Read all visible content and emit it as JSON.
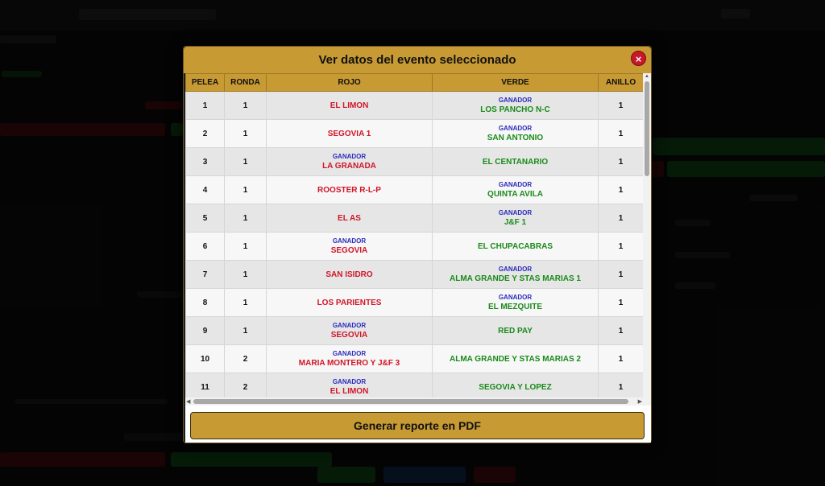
{
  "modal": {
    "title": "Ver datos del evento seleccionado",
    "close_label": "×",
    "footer_button": "Generar reporte en PDF"
  },
  "table": {
    "headers": [
      "PELEA",
      "RONDA",
      "ROJO",
      "VERDE",
      "ANILLO"
    ],
    "winner_label": "GANADOR",
    "rows": [
      {
        "pelea": "1",
        "ronda": "1",
        "rojo": "EL LIMON",
        "verde": "LOS PANCHO N-C",
        "anillo": "1",
        "winner": "verde"
      },
      {
        "pelea": "2",
        "ronda": "1",
        "rojo": "SEGOVIA 1",
        "verde": "SAN ANTONIO",
        "anillo": "1",
        "winner": "verde"
      },
      {
        "pelea": "3",
        "ronda": "1",
        "rojo": "LA GRANADA",
        "verde": "EL CENTANARIO",
        "anillo": "1",
        "winner": "rojo"
      },
      {
        "pelea": "4",
        "ronda": "1",
        "rojo": "ROOSTER R-L-P",
        "verde": "QUINTA AVILA",
        "anillo": "1",
        "winner": "verde"
      },
      {
        "pelea": "5",
        "ronda": "1",
        "rojo": "EL AS",
        "verde": "J&F 1",
        "anillo": "1",
        "winner": "verde"
      },
      {
        "pelea": "6",
        "ronda": "1",
        "rojo": "SEGOVIA",
        "verde": "EL CHUPACABRAS",
        "anillo": "1",
        "winner": "rojo"
      },
      {
        "pelea": "7",
        "ronda": "1",
        "rojo": "SAN ISIDRO",
        "verde": "ALMA GRANDE Y STAS MARIAS 1",
        "anillo": "1",
        "winner": "verde"
      },
      {
        "pelea": "8",
        "ronda": "1",
        "rojo": "LOS PARIENTES",
        "verde": "EL MEZQUITE",
        "anillo": "1",
        "winner": "verde"
      },
      {
        "pelea": "9",
        "ronda": "1",
        "rojo": "SEGOVIA",
        "verde": "RED PAY",
        "anillo": "1",
        "winner": "rojo"
      },
      {
        "pelea": "10",
        "ronda": "2",
        "rojo": "MARIA MONTERO Y J&F 3",
        "verde": "ALMA GRANDE Y STAS MARIAS 2",
        "anillo": "1",
        "winner": "rojo"
      },
      {
        "pelea": "11",
        "ronda": "2",
        "rojo": "EL LIMON",
        "verde": "SEGOVIA Y LOPEZ",
        "anillo": "1",
        "winner": "rojo"
      }
    ]
  },
  "colors": {
    "accent_gold": "#c79a33",
    "rojo_text": "#d01528",
    "verde_text": "#1a8a1a",
    "ganador_text": "#2b2bbd",
    "close_red": "#c8172a"
  }
}
